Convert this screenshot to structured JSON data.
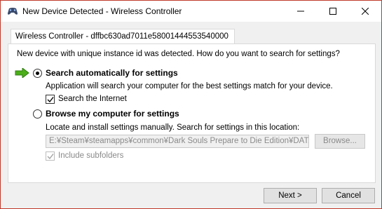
{
  "window": {
    "title": "New Device Detected - Wireless Controller",
    "app_icon": "gamepad-icon",
    "controls": {
      "minimize": "minimize-icon",
      "maximize": "maximize-icon",
      "close": "close-icon"
    }
  },
  "tab": {
    "label": "Wireless Controller - dffbc630ad7011e58001444553540000"
  },
  "prompt": "New device with unique instance id was detected. How do you want to search for settings?",
  "options": {
    "auto": {
      "label": "Search automatically for settings",
      "selected": true,
      "description": "Application will search your computer for the best settings match for your device.",
      "checkbox": {
        "label": "Search the Internet",
        "checked": true
      }
    },
    "browse": {
      "label": "Browse my computer for settings",
      "selected": false,
      "description": "Locate and install settings manually. Search for settings in this location:",
      "path_value": "E:¥Steam¥steamapps¥common¥Dark Souls Prepare to Die Edition¥DATA",
      "browse_label": "Browse...",
      "checkbox": {
        "label": "Include subfolders",
        "checked": true,
        "disabled": true
      }
    }
  },
  "footer": {
    "next_label": "Next >",
    "cancel_label": "Cancel"
  },
  "colors": {
    "arrow": "#4caf1a",
    "window_border": "#c0392b",
    "disabled_text": "#8a8a8a"
  }
}
